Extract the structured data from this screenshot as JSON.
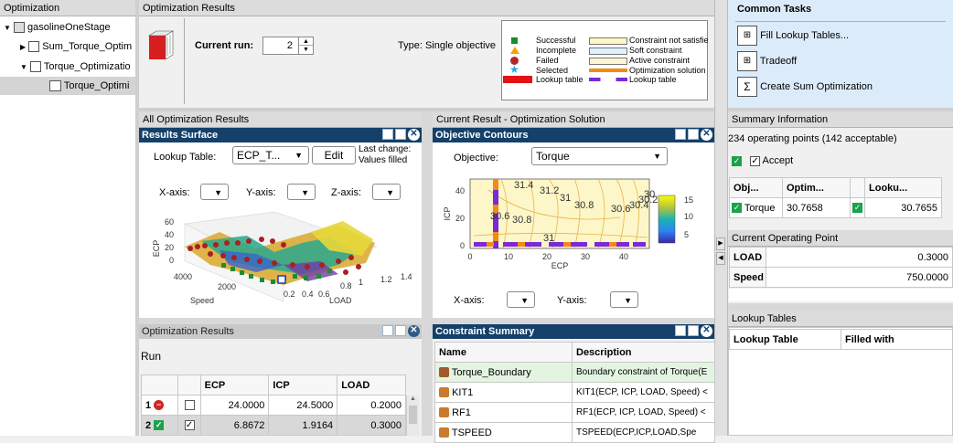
{
  "left": {
    "header": "Optimization",
    "tree": [
      {
        "label": "gasolineOneStage"
      },
      {
        "label": "Sum_Torque_Optim"
      },
      {
        "label": "Torque_Optimizatio"
      },
      {
        "label": "Torque_Optimi"
      }
    ]
  },
  "results": {
    "header": "Optimization Results",
    "current_run_label": "Current run:",
    "current_run_value": "2",
    "type_text": "Type: Single objective",
    "legend_left": [
      "Successful",
      "Incomplete",
      "Failed",
      "Selected",
      "Lookup table"
    ],
    "legend_right": [
      "Constraint not satisfie",
      "Soft constraint",
      "Active constraint",
      "Optimization solution",
      "Lookup table"
    ]
  },
  "tasks": {
    "header": "Common Tasks",
    "items": [
      "Fill Lookup Tables...",
      "Tradeoff",
      "Create Sum Optimization"
    ]
  },
  "all_results": {
    "header": "All Optimization Results",
    "surface_title": "Results Surface",
    "lookup_label": "Lookup Table:",
    "lookup_value": "ECP_T...",
    "edit_label": "Edit",
    "last_change": "Last change:",
    "values_filled": "Values filled",
    "xaxis_label": "X-axis:",
    "yaxis_label": "Y-axis:",
    "zaxis_label": "Z-axis:",
    "z_ticks": [
      "60",
      "40",
      "20",
      "0"
    ],
    "z_axis_title": "ECP",
    "speed_ticks": [
      "4000",
      "2000"
    ],
    "speed_label": "Speed",
    "load_ticks": [
      "0.2",
      "0.4",
      "0.6",
      "0.8",
      "1",
      "1.2",
      "1.4"
    ],
    "load_label": "LOAD"
  },
  "current_result": {
    "header": "Current Result - Optimization Solution",
    "contour_title": "Objective Contours",
    "objective_label": "Objective:",
    "objective_value": "Torque",
    "y_ticks": [
      "40",
      "20",
      "0"
    ],
    "y_label": "ICP",
    "x_ticks": [
      "0",
      "10",
      "20",
      "30",
      "40"
    ],
    "x_label": "ECP",
    "colorbar_ticks": [
      "15",
      "10",
      "5"
    ],
    "contour_labels": [
      "31.4",
      "31.2",
      "31",
      "30.8",
      "30.6",
      "30.4",
      "30.2",
      "30",
      "30.6",
      "30.8",
      "31"
    ],
    "xaxis_label": "X-axis:",
    "yaxis_label": "Y-axis:"
  },
  "opt_results": {
    "header": "Optimization Results",
    "run_label": "Run",
    "columns": [
      "",
      "",
      "ECP",
      "ICP",
      "LOAD"
    ],
    "rows": [
      {
        "index": "1",
        "ecp": "24.0000",
        "icp": "24.5000",
        "load": "0.2000"
      },
      {
        "index": "2",
        "ecp": "6.8672",
        "icp": "1.9164",
        "load": "0.3000"
      }
    ]
  },
  "constraints": {
    "header": "Constraint Summary",
    "columns": [
      "Name",
      "Description"
    ],
    "rows": [
      {
        "name": "Torque_Boundary",
        "desc": "Boundary constraint of Torque(E"
      },
      {
        "name": "KIT1",
        "desc": "KIT1(ECP, ICP, LOAD, Speed) <"
      },
      {
        "name": "RF1",
        "desc": "RF1(ECP, ICP, LOAD, Speed) <"
      },
      {
        "name": "TSPEED",
        "desc": "TSPEED(ECP,ICP,LOAD,Spe"
      }
    ]
  },
  "summary": {
    "header": "Summary Information",
    "points_text": "234 operating points (142 acceptable)",
    "accept_label": "Accept",
    "columns": [
      "Obj...",
      "Optim...",
      "",
      "Looku..."
    ],
    "row": {
      "obj": "Torque",
      "optim": "30.7658",
      "lookup": "30.7655"
    }
  },
  "operating_point": {
    "header": "Current Operating Point",
    "rows": [
      {
        "label": "LOAD",
        "value": "0.3000"
      },
      {
        "label": "Speed",
        "value": "750.0000"
      }
    ]
  },
  "lookup_tables": {
    "header": "Lookup Tables",
    "columns": [
      "Lookup Table",
      "Filled with"
    ]
  }
}
